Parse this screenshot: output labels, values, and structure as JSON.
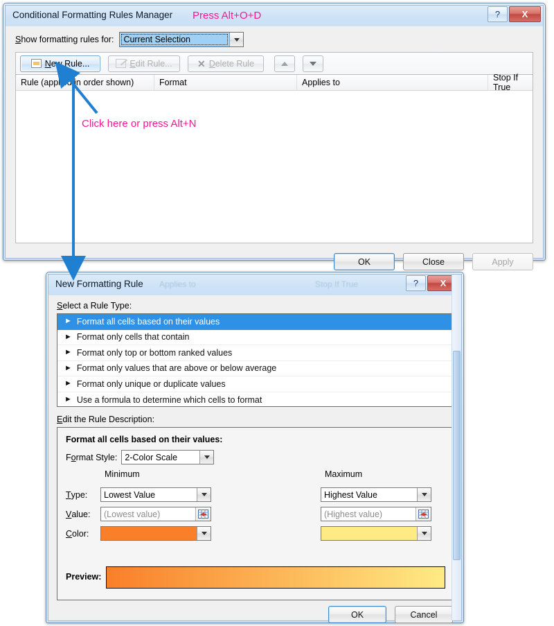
{
  "annotations": {
    "top_hint": "Press Alt+O+D",
    "click_hint": "Click here or press Alt+N",
    "color": "#ff1493"
  },
  "dialog1": {
    "title": "Conditional Formatting Rules Manager",
    "help_glyph": "?",
    "close_glyph": "X",
    "show_rules_label": "Show formatting rules for:",
    "show_rules_value": "Current Selection",
    "toolbar": [
      {
        "label": "New Rule...",
        "icon": "new-rule-icon",
        "enabled": true
      },
      {
        "label": "Edit Rule...",
        "icon": "edit-rule-icon",
        "enabled": false
      },
      {
        "label": "Delete Rule",
        "icon": "delete-rule-icon",
        "enabled": false
      },
      {
        "label": "",
        "icon": "move-up-icon",
        "enabled": false
      },
      {
        "label": "",
        "icon": "move-down-icon",
        "enabled": false
      }
    ],
    "columns": [
      "Rule (applied in order shown)",
      "Format",
      "Applies to",
      "Stop If True"
    ],
    "rows": [],
    "buttons": [
      {
        "label": "OK",
        "default": true,
        "enabled": true
      },
      {
        "label": "Close",
        "default": false,
        "enabled": true
      },
      {
        "label": "Apply",
        "default": false,
        "enabled": false
      }
    ]
  },
  "dialog2": {
    "title": "New Formatting Rule",
    "ghost_text_1": "Applies to",
    "ghost_text_2": "Stop If True",
    "help_glyph": "?",
    "close_glyph": "X",
    "rule_type_label": "Select a Rule Type:",
    "rule_types": [
      {
        "label": "Format all cells based on their values",
        "selected": true
      },
      {
        "label": "Format only cells that contain",
        "selected": false
      },
      {
        "label": "Format only top or bottom ranked values",
        "selected": false
      },
      {
        "label": "Format only values that are above or below average",
        "selected": false
      },
      {
        "label": "Format only unique or duplicate values",
        "selected": false
      },
      {
        "label": "Use a formula to determine which cells to format",
        "selected": false
      }
    ],
    "edit_desc_label": "Edit the Rule Description:",
    "desc_heading": "Format all cells based on their values:",
    "format_style_label": "Format Style:",
    "format_style_value": "2-Color Scale",
    "minimum_label": "Minimum",
    "maximum_label": "Maximum",
    "field_labels": {
      "type": "Type:",
      "value": "Value:",
      "color": "Color:"
    },
    "minimum": {
      "type": "Lowest Value",
      "value_placeholder": "(Lowest value)",
      "color": "#F97F28"
    },
    "maximum": {
      "type": "Highest Value",
      "value_placeholder": "(Highest value)",
      "color": "#FFEB84"
    },
    "preview_label": "Preview:",
    "preview_gradient_from": "#F97F28",
    "preview_gradient_to": "#FFEB84",
    "buttons": [
      {
        "label": "OK",
        "default": true,
        "enabled": true
      },
      {
        "label": "Cancel",
        "default": false,
        "enabled": true
      }
    ]
  }
}
